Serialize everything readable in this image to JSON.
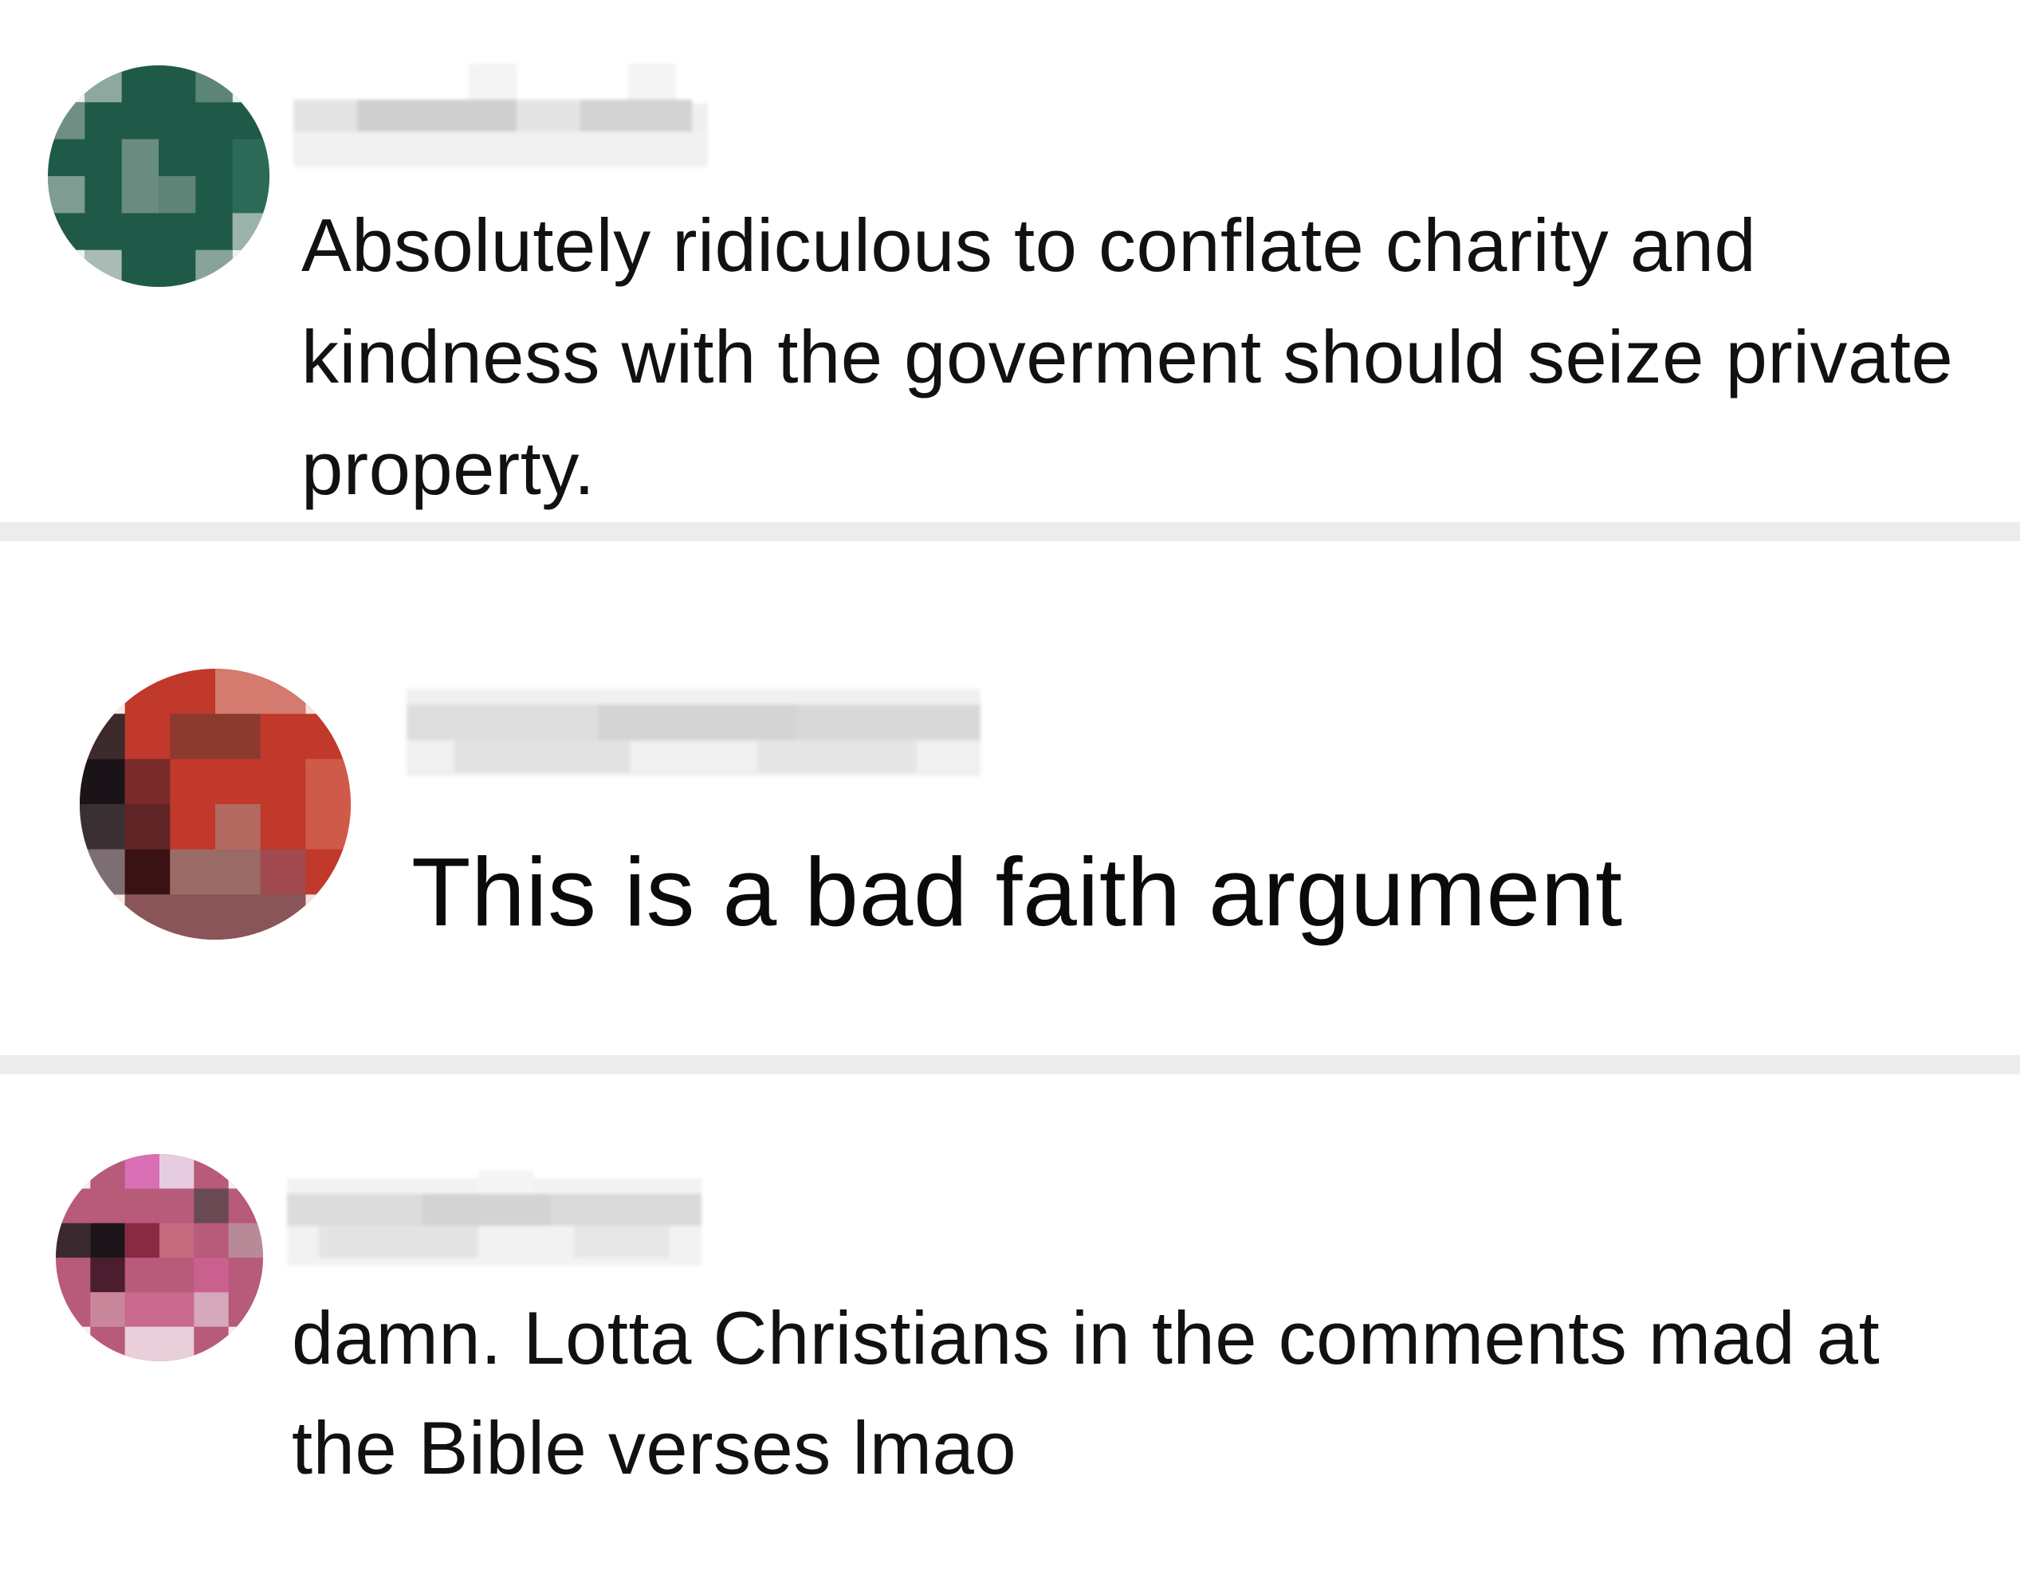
{
  "comments": [
    {
      "username": "",
      "avatar_color": "#1f5a49",
      "text": "Absolutely ridiculous to conflate charity and kindness with the goverment should seize private property."
    },
    {
      "username": "",
      "avatar_color": "#c0392b",
      "text": "This is a bad faith argument"
    },
    {
      "username": "",
      "avatar_color": "#b85a7a",
      "text": "damn. Lotta Christians in the comments mad at the Bible verses lmao"
    }
  ],
  "colors": {
    "divider": "#ececec",
    "text": "#111111",
    "username_placeholder": "#d9d9d9"
  },
  "icons": {
    "avatar": "pixelated-avatar-icon"
  }
}
